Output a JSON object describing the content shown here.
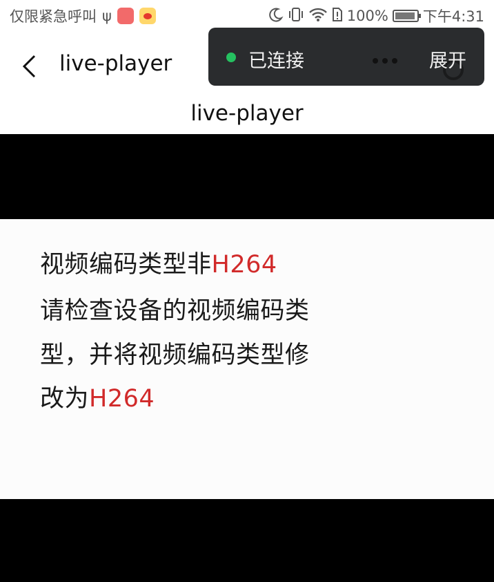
{
  "status_bar": {
    "left_text": "仅限紧急呼叫",
    "usb_glyph": "ψ",
    "battery": "100%",
    "time": "下午4:31",
    "icons": [
      "usb-icon",
      "app-notification-icon",
      "weibo-icon",
      "moon-icon",
      "vibrate-icon",
      "wifi-icon",
      "sim-icon",
      "battery-icon"
    ]
  },
  "nav": {
    "back_glyph": "‹",
    "title": "live-player"
  },
  "connection_popup": {
    "status": "已连接",
    "expand_label": "展开",
    "status_color": "#25c160"
  },
  "page": {
    "heading": "live-player"
  },
  "player_error": {
    "line1_text": "视频编码类型非",
    "line1_codec": "H264",
    "line2_text": "请检查设备的视频编码类",
    "line3_text": "型，并将视频编码类型修",
    "line4_text": "改为",
    "line4_codec": "H264",
    "highlight_color": "#d12a2a"
  }
}
